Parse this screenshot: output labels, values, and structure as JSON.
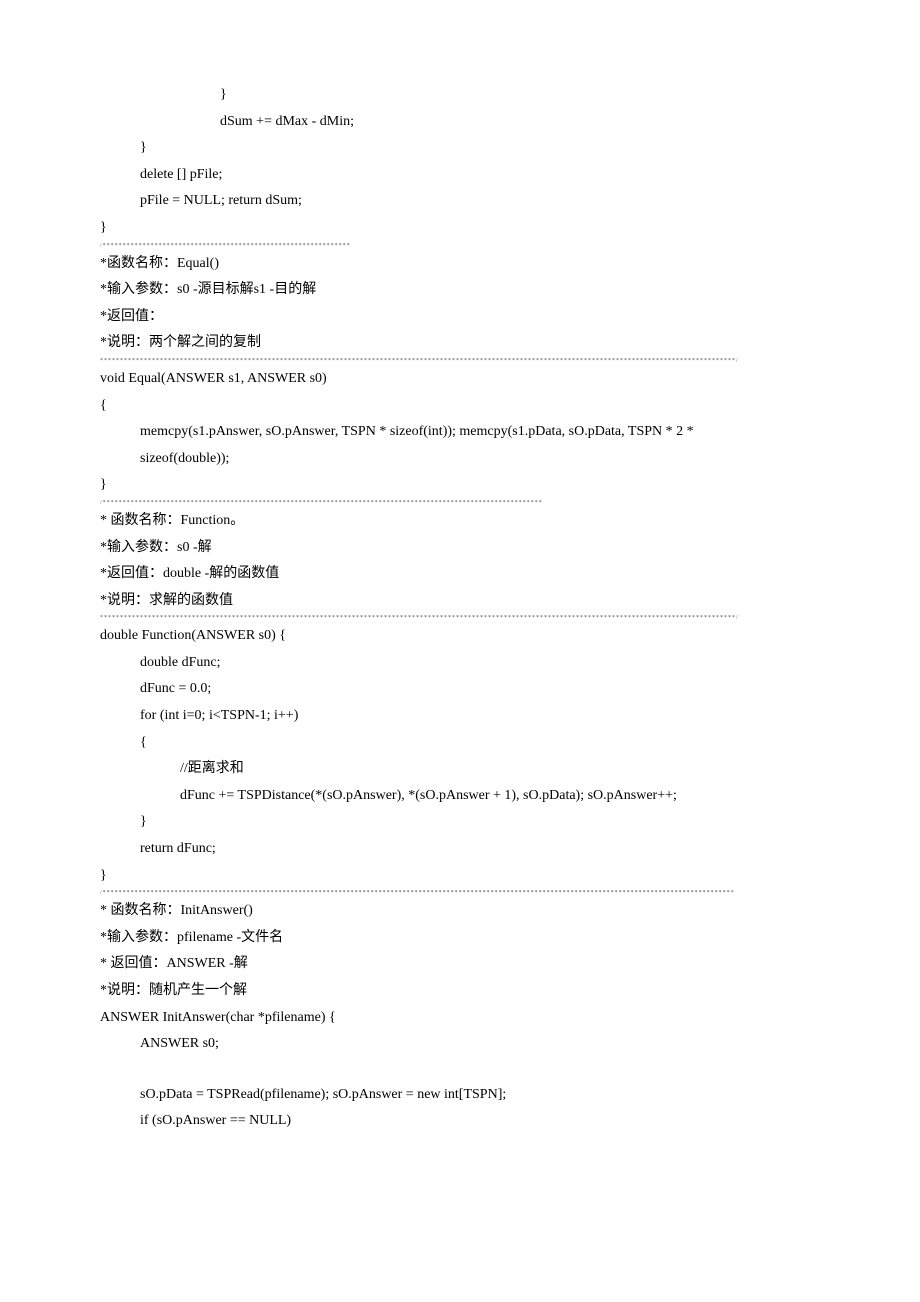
{
  "lines": [
    {
      "class": "indent3",
      "key": "close_brace_1",
      "text": "}"
    },
    {
      "class": "indent3",
      "key": "dsum_line",
      "text": "dSum += dMax - dMin;"
    },
    {
      "class": "indent1",
      "key": "close_brace_2",
      "text": "}"
    },
    {
      "class": "indent1",
      "key": "delete_pfile",
      "text": "delete [] pFile;"
    },
    {
      "class": "indent1",
      "key": "pfile_null",
      "text": "pFile = NULL; return dSum;"
    },
    {
      "class": "",
      "key": "close_brace_3",
      "text": "}"
    },
    {
      "class": "tiny-sep",
      "key": "sep1",
      "text": "/**************************************************************"
    },
    {
      "class": "",
      "key": "fn1_name",
      "text": "*函数名称：Equal()"
    },
    {
      "class": "",
      "key": "fn1_input",
      "text": "*输入参数：s0 -源目标解s1 -目的解"
    },
    {
      "class": "",
      "key": "fn1_return",
      "text": "*返回值："
    },
    {
      "class": "",
      "key": "fn1_desc",
      "text": "*说明：两个解之间的复制"
    },
    {
      "class": "tiny-sep",
      "key": "sep2",
      "text": "***************************************************************************************************************************************************************/"
    },
    {
      "class": "",
      "key": "equal_sig",
      "text": "void Equal(ANSWER s1, ANSWER s0)"
    },
    {
      "class": "",
      "key": "open_brace_1",
      "text": "{"
    },
    {
      "class": "indent1",
      "key": "memcpy1",
      "text": "memcpy(s1.pAnswer, sO.pAnswer, TSPN * sizeof(int)); memcpy(s1.pData, sO.pData, TSPN * 2 *"
    },
    {
      "class": "indent1",
      "key": "memcpy2",
      "text": "sizeof(double));"
    },
    {
      "class": "",
      "key": "close_brace_4",
      "text": "}"
    },
    {
      "class": "tiny-sep",
      "key": "sep3",
      "text": "/**************************************************************************************************************"
    },
    {
      "class": "",
      "key": "fn2_name",
      "text": "* 函数名称：Function。"
    },
    {
      "class": "",
      "key": "fn2_input",
      "text": "*输入参数：s0 -解"
    },
    {
      "class": "",
      "key": "fn2_return",
      "text": "*返回值：double -解的函数值"
    },
    {
      "class": "",
      "key": "fn2_desc",
      "text": "*说明：求解的函数值"
    },
    {
      "class": "tiny-sep",
      "key": "sep4",
      "text": "***************************************************************************************************************************************************************/"
    },
    {
      "class": "",
      "key": "func_sig",
      "text": "double Function(ANSWER s0) {"
    },
    {
      "class": "indent1",
      "key": "dfunc_decl",
      "text": "double dFunc;"
    },
    {
      "class": "indent1",
      "key": "dfunc_init",
      "text": "dFunc = 0.0;"
    },
    {
      "class": "indent1",
      "key": "for_loop",
      "text": "for (int i=0; i<TSPN-1; i++)"
    },
    {
      "class": "indent1",
      "key": "open_brace_2",
      "text": "{"
    },
    {
      "class": "indent2",
      "key": "comment1",
      "text": "//距离求和"
    },
    {
      "class": "indent2",
      "key": "dfunc_calc",
      "text": " dFunc += TSPDistance(*(sO.pAnswer), *(sO.pAnswer + 1), sO.pData); sO.pAnswer++;"
    },
    {
      "class": "indent1",
      "key": "close_brace_5",
      "text": "}"
    },
    {
      "class": "indent1",
      "key": "return_dfunc",
      "text": "return dFunc;"
    },
    {
      "class": "",
      "key": "close_brace_6",
      "text": "}"
    },
    {
      "class": "tiny-sep",
      "key": "sep5",
      "text": "/**************************************************************************************************************************************************************"
    },
    {
      "class": "",
      "key": "fn3_name",
      "text": "*    函数名称：InitAnswer()"
    },
    {
      "class": "",
      "key": "fn3_input",
      "text": "*输入参数：pfilename -文件名"
    },
    {
      "class": "",
      "key": "fn3_return",
      "text": "*    返回值：ANSWER -解"
    },
    {
      "class": "",
      "key": "fn3_desc",
      "text": "*说明：随机产生一个解"
    },
    {
      "class": "",
      "key": "init_sig",
      "text": "ANSWER InitAnswer(char *pfilename) {"
    },
    {
      "class": "indent1",
      "key": "answer_decl",
      "text": "ANSWER s0;"
    },
    {
      "class": "blank-line",
      "key": "blank1",
      "text": ""
    },
    {
      "class": "indent1",
      "key": "pdata_line",
      "text": "sO.pData = TSPRead(pfilename); sO.pAnswer = new int[TSPN];"
    },
    {
      "class": "indent1",
      "key": "if_null",
      "text": "if (sO.pAnswer == NULL)"
    }
  ]
}
